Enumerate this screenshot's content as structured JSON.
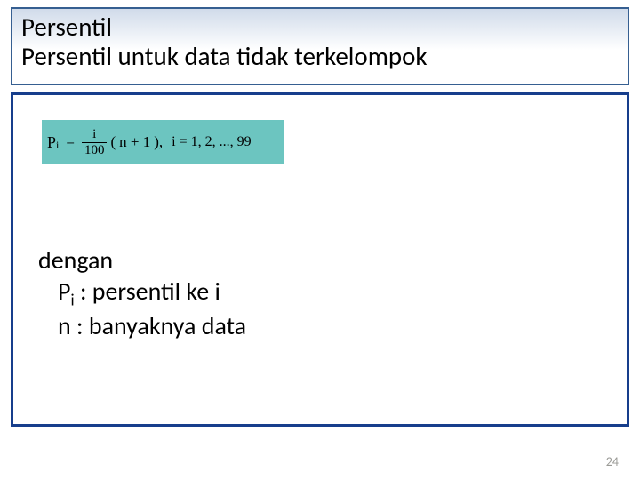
{
  "title": {
    "main": "Persentil",
    "sub": "Persentil untuk data tidak terkelompok"
  },
  "formula": {
    "lhs_symbol": "P",
    "lhs_sub": "i",
    "equals": "=",
    "frac_num": "i",
    "frac_den": "100",
    "paren_open": "(",
    "paren_inner": "n + 1",
    "paren_close": "),",
    "range": "i = 1, 2, ..., 99"
  },
  "defs": {
    "lead": "dengan",
    "line1_sym": "P",
    "line1_sub": "i",
    "line1_rest": " : persentil ke i",
    "line2_sym": "n",
    "line2_rest": "  : banyaknya data"
  },
  "page_number": "24",
  "chart_data": {
    "type": "table",
    "title": "Persentil untuk data tidak terkelompok",
    "formula_latex": "P_i = (i/100)(n+1), i = 1, 2, ..., 99",
    "variables": [
      {
        "symbol": "P_i",
        "meaning": "persentil ke i"
      },
      {
        "symbol": "n",
        "meaning": "banyaknya data"
      }
    ]
  }
}
